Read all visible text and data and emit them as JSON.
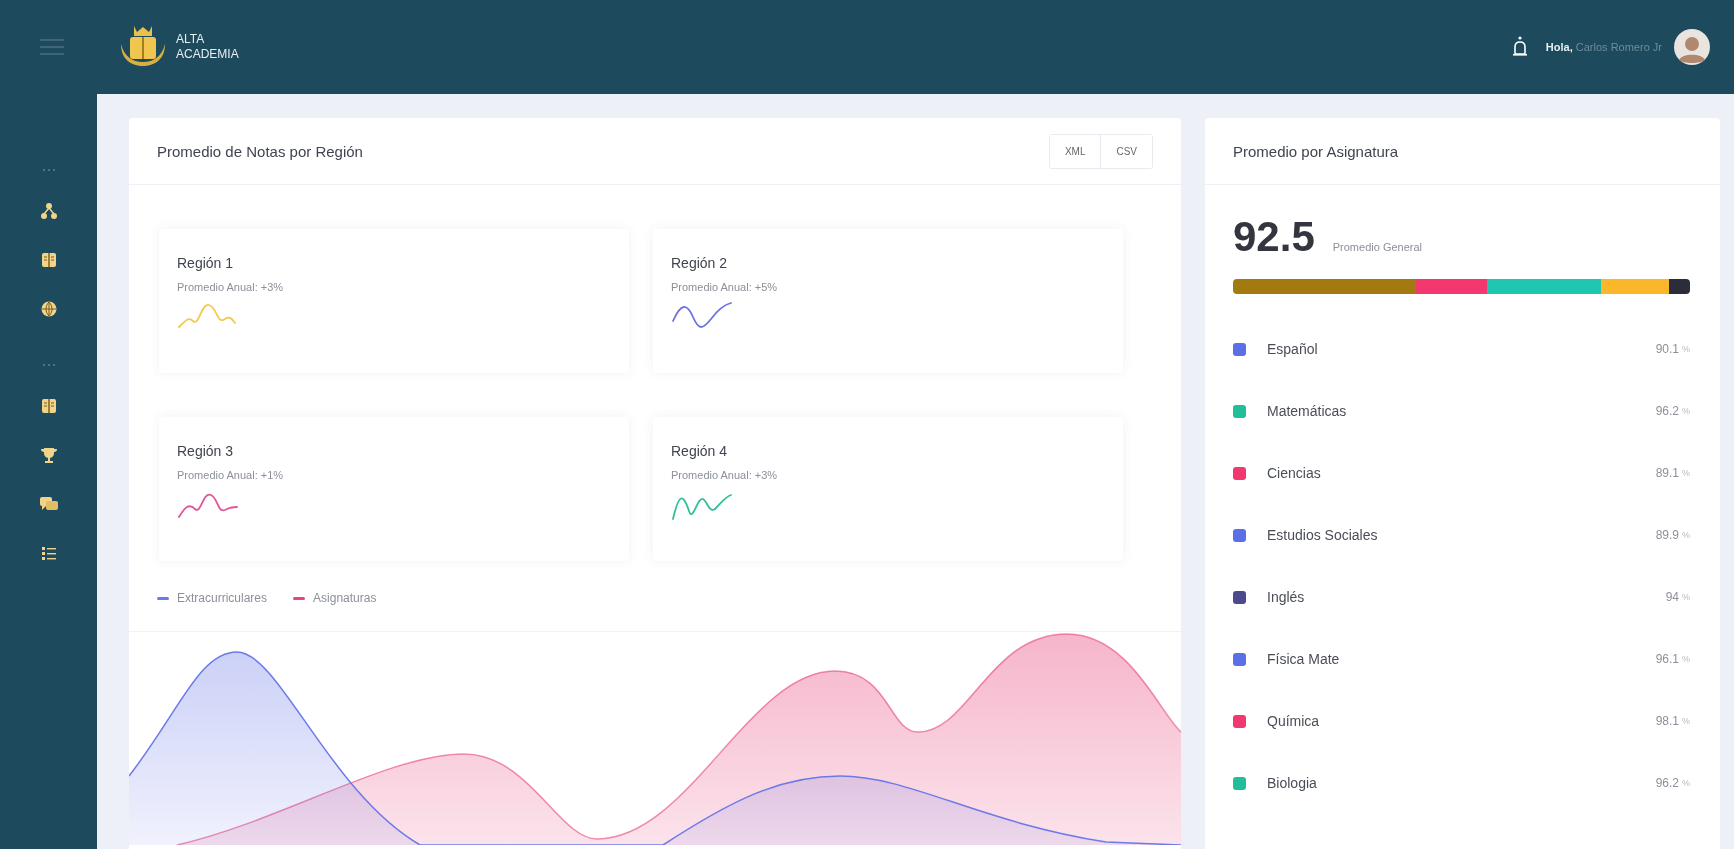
{
  "header": {
    "brand_lines": [
      "ALTA",
      "ACADEMIA"
    ],
    "greeting": "**Hola,** Carlos Romero Jr"
  },
  "sidebar": {
    "sections": [
      {
        "items": [
          {
            "kind": "hierarchy"
          },
          {
            "kind": "book"
          },
          {
            "kind": "globe"
          }
        ]
      },
      {
        "items": [
          {
            "kind": "book"
          },
          {
            "kind": "trophy"
          },
          {
            "kind": "chat"
          },
          {
            "kind": "list"
          }
        ]
      }
    ]
  },
  "regions_card": {
    "title": "Promedio de Notas por Región",
    "export_buttons": [
      "XML",
      "CSV"
    ],
    "regions": [
      {
        "name": "Región 1",
        "subtitle": "Promedio Anual:  +3%",
        "color": "#f2c94c"
      },
      {
        "name": "Región 2",
        "subtitle": "Promedio Anual:  +5%",
        "color": "#6c70e0"
      },
      {
        "name": "Región 3",
        "subtitle": "Promedio Anual:  +1%",
        "color": "#e0559a"
      },
      {
        "name": "Región 4",
        "subtitle": "Promedio Anual:  +3%",
        "color": "#2fbf9a"
      }
    ],
    "legend": [
      {
        "label": "Extracurriculares",
        "color": "#6b7ae8"
      },
      {
        "label": "Asignaturas",
        "color": "#e8457c"
      }
    ]
  },
  "subjects_card": {
    "title": "Promedio por Asignatura",
    "average": "92.5",
    "average_label": "Promedio General",
    "breakdown": [
      {
        "color": "#a37a10"
      },
      {
        "color": "#f2386e"
      },
      {
        "color": "#1fc6b0"
      },
      {
        "color": "#fbb72c"
      },
      {
        "color": "#2b2d3a"
      }
    ],
    "subjects": [
      {
        "name": "Español",
        "value": "90.1",
        "unit": "%",
        "color": "#5b6fe6"
      },
      {
        "name": "Matemáticas",
        "value": "96.2",
        "unit": "%",
        "color": "#1fbf9a"
      },
      {
        "name": "Ciencias",
        "value": "89.1",
        "unit": "%",
        "color": "#f0396e"
      },
      {
        "name": "Estudios Sociales",
        "value": "89.9",
        "unit": "%",
        "color": "#5b6fe6"
      },
      {
        "name": "Inglés",
        "value": "94",
        "unit": "%",
        "color": "#4c4a8c"
      },
      {
        "name": "Física Mate",
        "value": "96.1",
        "unit": "%",
        "color": "#5b6fe6"
      },
      {
        "name": "Química",
        "value": "98.1",
        "unit": "%",
        "color": "#f0396e"
      },
      {
        "name": "Biologia",
        "value": "96.2",
        "unit": "%",
        "color": "#1fbf9a"
      }
    ]
  }
}
